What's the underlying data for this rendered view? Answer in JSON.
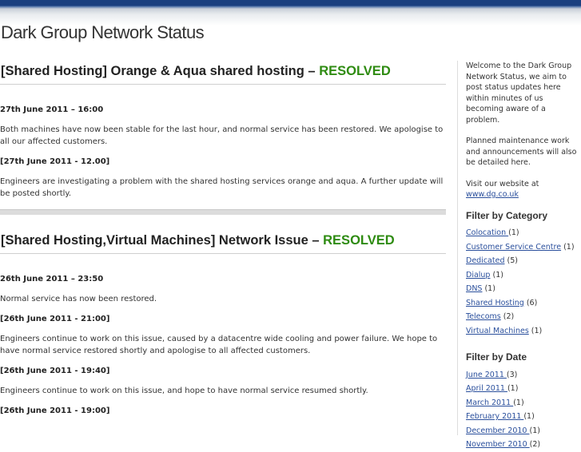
{
  "site": {
    "title": "Dark Group Network Status"
  },
  "posts": [
    {
      "title": "[Shared Hosting] Orange & Aqua shared hosting – ",
      "status": "RESOLVED",
      "entries": [
        {
          "head": "27th June 2011 – 16:00",
          "text": "Both machines have now been stable for the last hour, and normal service has been restored. We apologise to all our affected customers."
        },
        {
          "head": "[27th June 2011 - 12.00]",
          "text": "Engineers are investigating a problem with the shared hosting services orange and aqua. A further update will be posted shortly."
        }
      ]
    },
    {
      "title": "[Shared Hosting,Virtual Machines] Network Issue – ",
      "status": "RESOLVED",
      "entries": [
        {
          "head": "26th June 2011 – 23:50",
          "text": "Normal service has now been restored."
        },
        {
          "head": "[26th June 2011 - 21:00]",
          "text": "Engineers continue to work on this issue, caused by a datacentre wide cooling and power failure. We hope to have normal service restored shortly and apologise to all affected customers."
        },
        {
          "head": "[26th June 2011 - 19:40]",
          "text": "Engineers continue to work on this issue, and hope to have normal service resumed shortly."
        },
        {
          "head": "[26th June 2011 - 19:00]",
          "text": ""
        }
      ]
    }
  ],
  "sidebar": {
    "welcome": "Welcome to the Dark Group Network Status, we aim to post status updates here within minutes of us becoming aware of a problem.",
    "planned": "Planned maintenance work and announcements will also be detailed here.",
    "visit": "Visit our website at",
    "website_link": "www.dg.co.uk",
    "category_heading": "Filter by Category",
    "categories": [
      {
        "name": "Colocation ",
        "count": " (1)"
      },
      {
        "name": "Customer Service Centre",
        "count": " (1)"
      },
      {
        "name": "Dedicated",
        "count": " (5)"
      },
      {
        "name": "Dialup",
        "count": " (1)"
      },
      {
        "name": "DNS",
        "count": " (1)"
      },
      {
        "name": "Shared Hosting",
        "count": " (6)"
      },
      {
        "name": "Telecoms",
        "count": " (2)"
      },
      {
        "name": "Virtual Machines",
        "count": " (1)"
      }
    ],
    "date_heading": "Filter by Date",
    "dates": [
      {
        "name": "June 2011 ",
        "count": " (3)"
      },
      {
        "name": "April 2011 ",
        "count": " (1)"
      },
      {
        "name": "March 2011 ",
        "count": " (1)"
      },
      {
        "name": "February 2011 ",
        "count": " (1)"
      },
      {
        "name": "December 2010 ",
        "count": " (1)"
      },
      {
        "name": "November 2010 ",
        "count": " (2)"
      }
    ]
  }
}
